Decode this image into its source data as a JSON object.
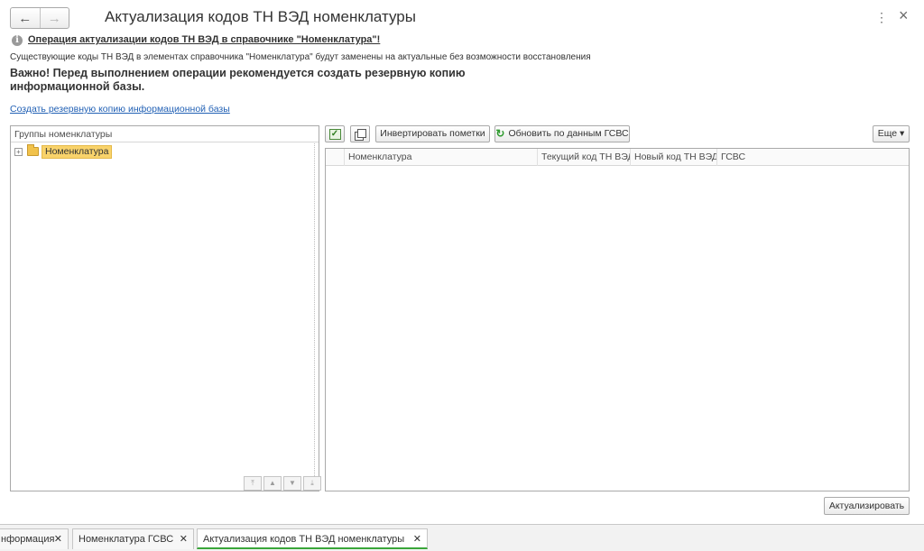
{
  "header": {
    "title": "Актуализация кодов ТН ВЭД номенклатуры",
    "back_icon": "←",
    "forward_icon": "→",
    "more_icon": "⋮",
    "close_icon": "×"
  },
  "info": {
    "icon": "i",
    "warning_title": "Операция актуализации кодов ТН ВЭД в справочнике \"Номенклатура\"!",
    "description": "Существующие коды ТН ВЭД в элементах справочника \"Номенклатура\" будут заменены на актуальные без возможности восстановления",
    "important": "Важно! Перед выполнением операции рекомендуется создать резервную копию информационной базы.",
    "backup_link": "Создать резервную копию информационной базы"
  },
  "groups_panel": {
    "header": "Группы номенклатуры",
    "tree": [
      {
        "label": "Номенклатура",
        "expand": "+",
        "selected": true
      }
    ],
    "movers": [
      "⤒",
      "▲",
      "▼",
      "⤓"
    ]
  },
  "toolbar": {
    "check_icon": "✓",
    "invert_label": "Инвертировать пометки",
    "refresh_icon": "↻",
    "refresh_label": "Обновить по данным ГСВС",
    "more_label": "Еще ▾"
  },
  "grid": {
    "columns": [
      "",
      "Номенклатура",
      "Текущий код ТН ВЭД",
      "Новый код ТН ВЭД",
      "ГСВС"
    ]
  },
  "actions": {
    "submit_label": "Актуализировать"
  },
  "tabs": [
    {
      "label": "нформация",
      "close": "✕",
      "active": false
    },
    {
      "label": "Номенклатура ГСВС",
      "close": "✕",
      "active": false
    },
    {
      "label": "Актуализация кодов ТН ВЭД номенклатуры",
      "close": "✕",
      "active": true
    }
  ],
  "colors": {
    "accent_green": "#3aa63a",
    "link_blue": "#2261b5",
    "selection_yellow": "#f9d36b"
  }
}
